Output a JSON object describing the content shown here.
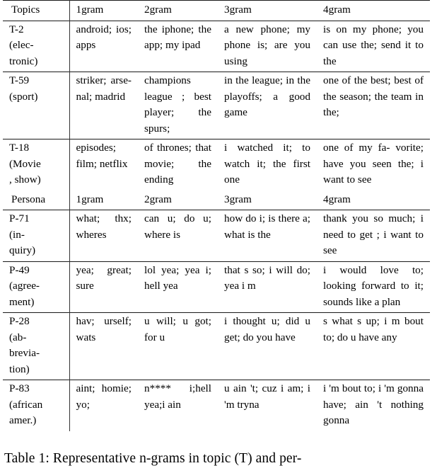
{
  "table": {
    "caption": "Table 1: Representative n-grams in topic (T) and per-",
    "sections": [
      {
        "header": {
          "label": "Topics",
          "col1": "1gram",
          "col2": "2gram",
          "col3": "3gram",
          "col4": "4gram"
        },
        "rows": [
          {
            "label": "T-2 (elec- tronic)",
            "label_lines": [
              "T-2",
              "(elec-",
              "tronic)"
            ],
            "col1": "android; ios; apps",
            "col2": "the iphone; the app; my ipad",
            "col3": "a new phone; my phone is; are you using",
            "col4": "is on my phone; you can use the; send it to the"
          },
          {
            "label": "T-59 (sport)",
            "label_lines": [
              "T-59",
              "(sport)"
            ],
            "col1": "striker; arse- nal; madrid",
            "col2": "champions league ; best player; the spurs;",
            "col3": "in the league; in the playoffs; a good game",
            "col4": "one of the best; best of the season; the team in the;"
          },
          {
            "label": "T-18 (Movie , show)",
            "label_lines": [
              "T-18",
              "(Movie",
              ", show)"
            ],
            "col1": "episodes; film; netflix",
            "col2": "of thrones; that movie; the ending",
            "col3": "i watched it; to watch it; the first one",
            "col4": "one of my fa- vorite; have you seen the; i want to see"
          }
        ]
      },
      {
        "header": {
          "label": "Persona",
          "col1": "1gram",
          "col2": "2gram",
          "col3": "3gram",
          "col4": "4gram"
        },
        "rows": [
          {
            "label": "P-71 (in- quiry)",
            "label_lines": [
              "P-71",
              "(in-",
              "quiry)"
            ],
            "col1": "what; thx; wheres",
            "col2": "can u; do u; where is",
            "col3": "how do i; is there a; what is the",
            "col4": "thank you so much; i need to get ; i want to see"
          },
          {
            "label": "P-49 (agree- ment)",
            "label_lines": [
              "P-49",
              "(agree-",
              "ment)"
            ],
            "col1": "yea; great; sure",
            "col2": "lol yea; yea i; hell yea",
            "col3": "that s so; i will do; yea i m",
            "col4": "i would love to; looking forward to it; sounds like a plan"
          },
          {
            "label": "P-28 (ab- brevia- tion)",
            "label_lines": [
              "P-28",
              "(ab-",
              "brevia-",
              "tion)"
            ],
            "col1": "hav; urself; wats",
            "col2": "u will; u got; for u",
            "col3": "i thought u; did u get; do you have",
            "col4": "s what s up; i m bout to; do u have any"
          },
          {
            "label": "P-83 (african amer.)",
            "label_lines": [
              "P-83",
              "(african",
              "amer.)"
            ],
            "col1": "aint; homie; yo;",
            "col2": "n**** i;hell yea;i ain",
            "col3": "u ain 't; cuz i am; i 'm tryna",
            "col4": "i 'm bout to; i 'm gonna have; ain 't nothing gonna"
          }
        ]
      }
    ]
  }
}
